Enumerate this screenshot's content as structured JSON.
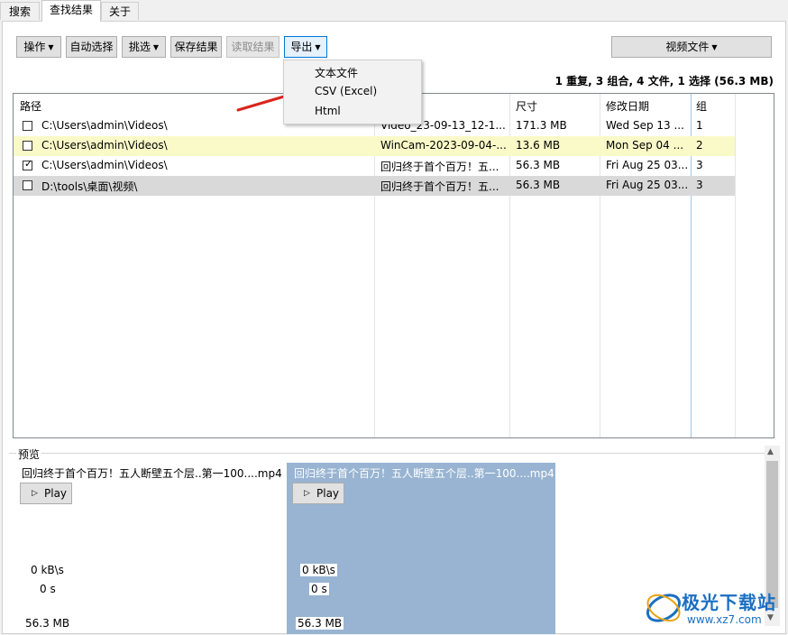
{
  "tabs": [
    {
      "label": "搜索",
      "active": false
    },
    {
      "label": "查找结果",
      "active": true
    },
    {
      "label": "关于",
      "active": false
    }
  ],
  "toolbar": {
    "operate_label": "操作",
    "auto_select_label": "自动选择",
    "filter_label": "挑选",
    "save_results_label": "保存结果",
    "load_results_label": "读取结果",
    "export_label": "导出",
    "file_type_label": "视频文件"
  },
  "summary": "1 重复, 3 组合, 4 文件, 1 选择 (56.3 MB)",
  "table": {
    "columns": [
      "路径",
      "尺寸",
      "修改日期",
      "组"
    ],
    "rows": [
      {
        "checked": false,
        "path": "C:\\Users\\admin\\Videos\\",
        "name": "Video_23-09-13_12-1...",
        "size": "171.3 MB",
        "date": "Wed Sep 13 ...",
        "group": "1",
        "highlight": "none"
      },
      {
        "checked": false,
        "path": "C:\\Users\\admin\\Videos\\",
        "name": "WinCam-2023-09-04-...",
        "size": "13.6 MB",
        "date": "Mon Sep 04 ...",
        "group": "2",
        "highlight": "yellow"
      },
      {
        "checked": true,
        "path": "C:\\Users\\admin\\Videos\\",
        "name": "回归终于首个百万！五...",
        "size": "56.3 MB",
        "date": "Fri Aug 25 03...",
        "group": "3",
        "highlight": "none"
      },
      {
        "checked": false,
        "path": "D:\\tools\\桌面\\视频\\",
        "name": "回归终于首个百万！五...",
        "size": "56.3 MB",
        "date": "Fri Aug 25 03...",
        "group": "3",
        "highlight": "gray"
      }
    ]
  },
  "export_menu": {
    "items": [
      "文本文件",
      "CSV (Excel)",
      "Html"
    ]
  },
  "preview": {
    "label": "预览",
    "cards": [
      {
        "title": "回归终于首个百万！五人断壁五个层..第一100....mp4",
        "play_label": "Play",
        "speed": "0 kB\\s",
        "time": "0 s",
        "size": "56.3 MB",
        "selected": false
      },
      {
        "title": "回归终于首个百万！五人断壁五个层..第一100....mp4",
        "play_label": "Play",
        "speed": "0 kB\\s",
        "time": "0 s",
        "size": "56.3 MB",
        "selected": true
      }
    ]
  },
  "watermark": {
    "name": "极光下载站",
    "url": "www.xz7.com"
  },
  "colors": {
    "row_yellow": "#fafac8",
    "row_gray": "#d9d9d9",
    "preview_selected": "#98b4d2",
    "arrow_red": "#d9251c",
    "accent_blue": "#0078d7"
  }
}
